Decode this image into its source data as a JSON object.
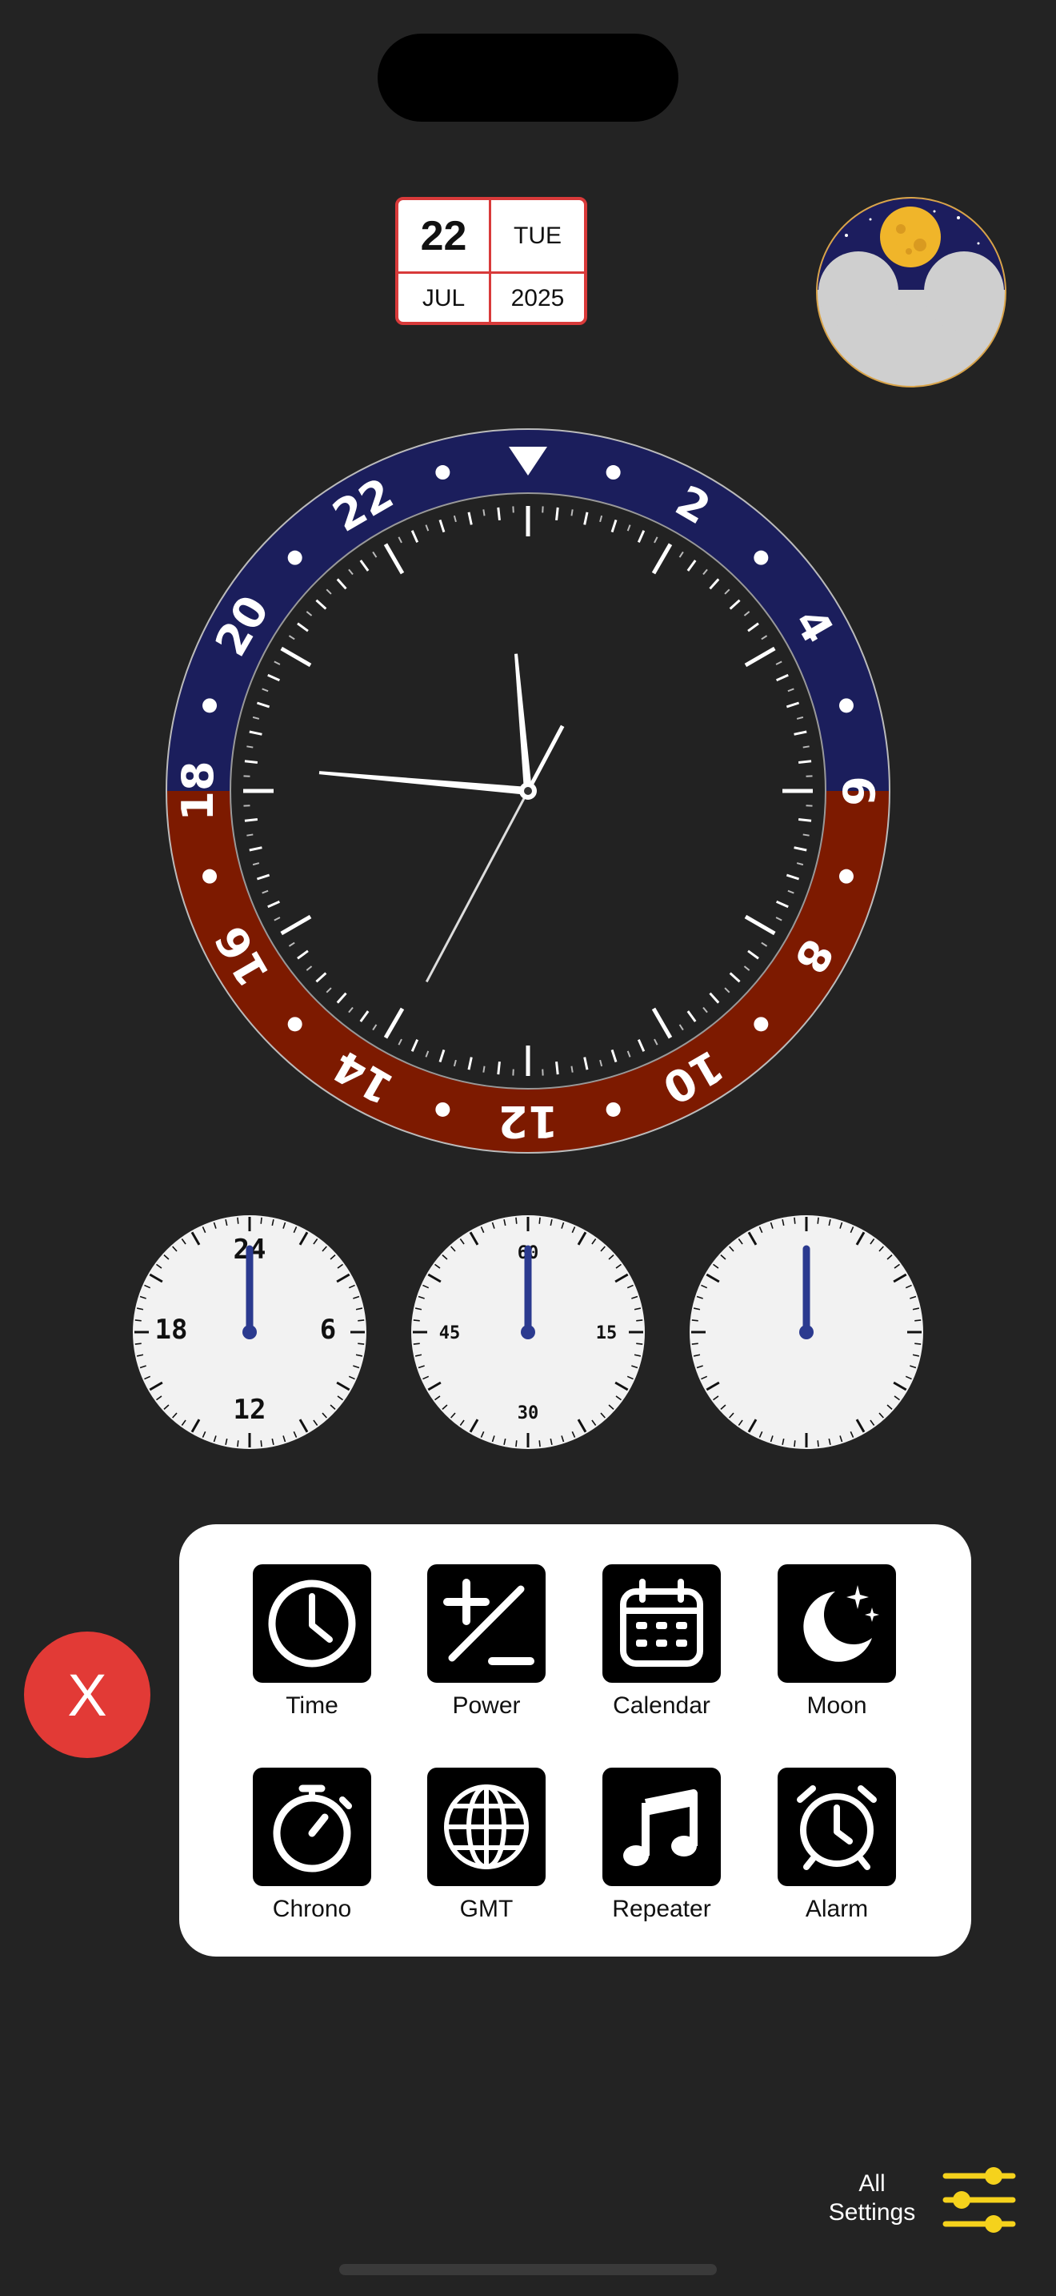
{
  "date": {
    "day": "22",
    "weekday": "TUE",
    "month": "JUL",
    "year": "2025"
  },
  "bezel": {
    "numbers": [
      "2",
      "4",
      "6",
      "8",
      "10",
      "12",
      "14",
      "16",
      "18",
      "20",
      "22"
    ],
    "top_color": "#1b1e5c",
    "bottom_color": "#7d1a00"
  },
  "subdials": [
    {
      "labels": [
        "24",
        "6",
        "12",
        "18"
      ]
    },
    {
      "labels": [
        "60",
        "15",
        "30",
        "45"
      ]
    },
    {
      "labels": []
    }
  ],
  "shortcuts": [
    {
      "label": "Time",
      "icon": "clock-icon"
    },
    {
      "label": "Power",
      "icon": "plus-minus-icon"
    },
    {
      "label": "Calendar",
      "icon": "calendar-icon"
    },
    {
      "label": "Moon",
      "icon": "moon-stars-icon"
    },
    {
      "label": "Chrono",
      "icon": "stopwatch-icon"
    },
    {
      "label": "GMT",
      "icon": "globe-icon"
    },
    {
      "label": "Repeater",
      "icon": "music-note-icon"
    },
    {
      "label": "Alarm",
      "icon": "alarm-clock-icon"
    }
  ],
  "close_label": "X",
  "all_settings_line1": "All",
  "all_settings_line2": "Settings",
  "colors": {
    "accent_yellow": "#f5d21c",
    "close_red": "#e23a36",
    "hand_blue": "#2b3a8f"
  }
}
